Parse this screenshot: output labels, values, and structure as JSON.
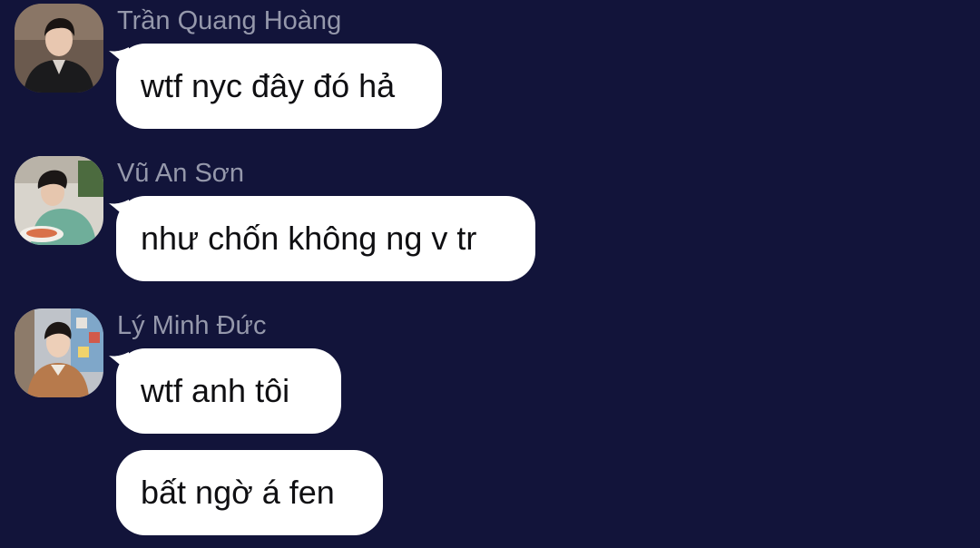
{
  "theme": {
    "background": "#12143a",
    "bubble_color": "#ffffff",
    "sender_color": "#9598ab",
    "text_color": "#0f0f12"
  },
  "messages": [
    {
      "sender": "Trần Quang Hoàng",
      "text": "wtf nyc đây đó hả"
    },
    {
      "sender": "Vũ An Sơn",
      "text": "như chốn không ng v tr"
    },
    {
      "sender": "Lý Minh Đức",
      "text": "wtf anh tôi"
    },
    {
      "sender": "",
      "text": "bất ngờ á fen"
    }
  ]
}
